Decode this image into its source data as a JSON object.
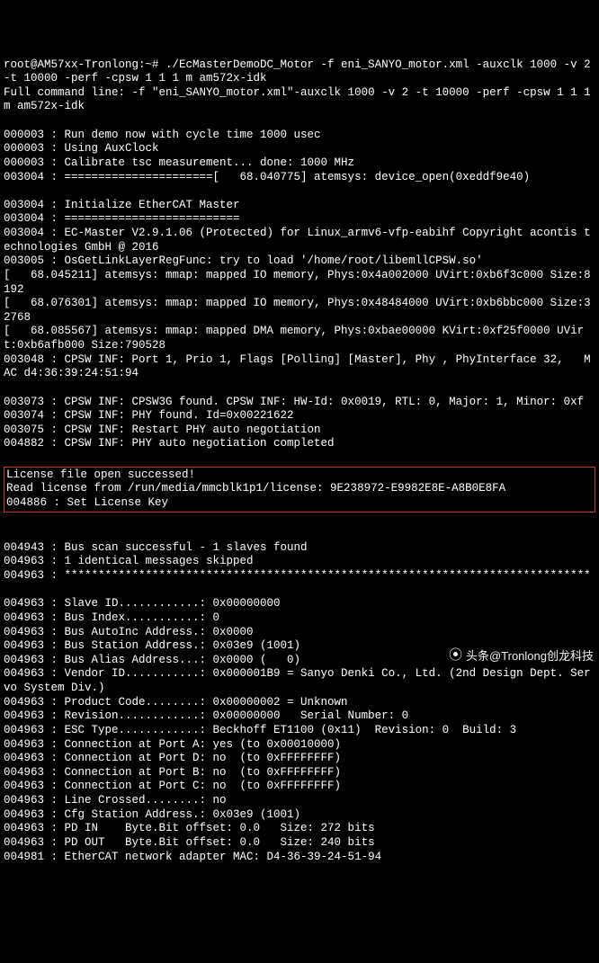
{
  "lines_before": [
    "root@AM57xx-Tronlong:~# ./EcMasterDemoDC_Motor -f eni_SANYO_motor.xml -auxclk 1000 -v 2 -t 10000 -perf -cpsw 1 1 1 m am572x-idk",
    "Full command line: -f \"eni_SANYO_motor.xml\"-auxclk 1000 -v 2 -t 10000 -perf -cpsw 1 1 1 m am572x-idk",
    "",
    "000003 : Run demo now with cycle time 1000 usec",
    "000003 : Using AuxClock",
    "000003 : Calibrate tsc measurement... done: 1000 MHz",
    "003004 : ======================[   68.040775] atemsys: device_open(0xeddf9e40)",
    "",
    "003004 : Initialize EtherCAT Master",
    "003004 : ==========================",
    "003004 : EC-Master V2.9.1.06 (Protected) for Linux_armv6-vfp-eabihf Copyright acontis technologies GmbH @ 2016",
    "003005 : OsGetLinkLayerRegFunc: try to load '/home/root/libemllCPSW.so'",
    "[   68.045211] atemsys: mmap: mapped IO memory, Phys:0x4a002000 UVirt:0xb6f3c000 Size:8192",
    "[   68.076301] atemsys: mmap: mapped IO memory, Phys:0x48484000 UVirt:0xb6bbc000 Size:32768",
    "[   68.085567] atemsys: mmap: mapped DMA memory, Phys:0xbae00000 KVirt:0xf25f0000 UVirt:0xb6afb000 Size:790528",
    "003048 : CPSW INF: Port 1, Prio 1, Flags [Polling] [Master], Phy , PhyInterface 32,   MAC d4:36:39:24:51:94",
    "",
    "003073 : CPSW INF: CPSW3G found. CPSW INF: HW-Id: 0x0019, RTL: 0, Major: 1, Minor: 0xf",
    "003074 : CPSW INF: PHY found. Id=0x00221622",
    "003075 : CPSW INF: Restart PHY auto negotiation",
    "004882 : CPSW INF: PHY auto negotiation completed"
  ],
  "highlight_lines": [
    "License file open successed!",
    "Read license from /run/media/mmcblk1p1/license: 9E238972-E9982E8E-A8B0E8FA",
    "004886 : Set License Key"
  ],
  "lines_after": [
    "",
    "004943 : Bus scan successful - 1 slaves found",
    "004963 : 1 identical messages skipped",
    "004963 : ******************************************************************************",
    "",
    "004963 : Slave ID............: 0x00000000",
    "004963 : Bus Index...........: 0",
    "004963 : Bus AutoInc Address.: 0x0000",
    "004963 : Bus Station Address.: 0x03e9 (1001)",
    "004963 : Bus Alias Address...: 0x0000 (   0)",
    "004963 : Vendor ID...........: 0x000001B9 = Sanyo Denki Co., Ltd. (2nd Design Dept. Servo System Div.)",
    "004963 : Product Code........: 0x00000002 = Unknown",
    "004963 : Revision............: 0x00000000   Serial Number: 0",
    "004963 : ESC Type............: Beckhoff ET1100 (0x11)  Revision: 0  Build: 3",
    "004963 : Connection at Port A: yes (to 0x00010000)",
    "004963 : Connection at Port D: no  (to 0xFFFFFFFF)",
    "004963 : Connection at Port B: no  (to 0xFFFFFFFF)",
    "004963 : Connection at Port C: no  (to 0xFFFFFFFF)",
    "004963 : Line Crossed........: no",
    "004963 : Cfg Station Address.: 0x03e9 (1001)",
    "004963 : PD IN    Byte.Bit offset: 0.0   Size: 272 bits",
    "004963 : PD OUT   Byte.Bit offset: 0.0   Size: 240 bits",
    "004981 : EtherCAT network adapter MAC: D4-36-39-24-51-94"
  ],
  "watermark": {
    "text": "头条@Tronlong创龙科技"
  }
}
